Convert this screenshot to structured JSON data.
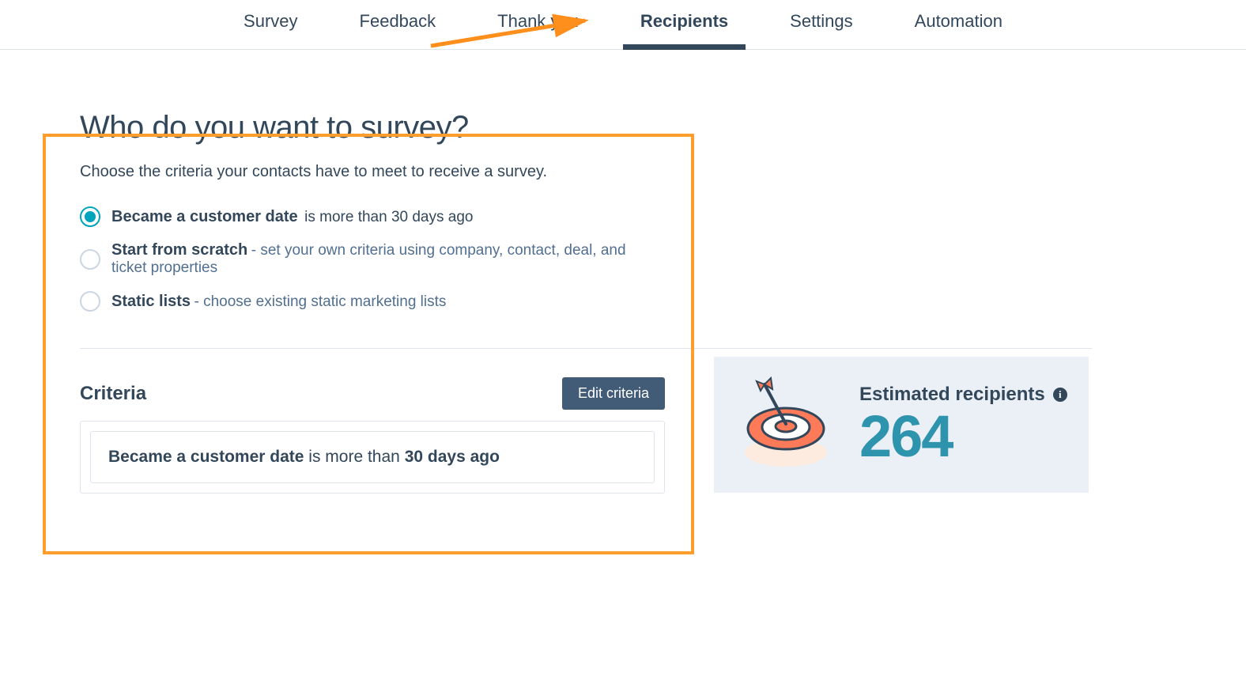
{
  "tabs": {
    "items": [
      {
        "label": "Survey",
        "active": false
      },
      {
        "label": "Feedback",
        "active": false
      },
      {
        "label": "Thank you",
        "active": false
      },
      {
        "label": "Recipients",
        "active": true
      },
      {
        "label": "Settings",
        "active": false
      },
      {
        "label": "Automation",
        "active": false
      }
    ]
  },
  "page": {
    "title": "Who do you want to survey?",
    "description": "Choose the criteria your contacts have to meet to receive a survey."
  },
  "options": [
    {
      "label": "Became a customer date",
      "suffix": "is more than 30 days ago",
      "selected": true
    },
    {
      "label": "Start from scratch",
      "description": "- set your own criteria using company, contact, deal, and ticket properties",
      "selected": false
    },
    {
      "label": "Static lists",
      "description": "- choose existing static marketing lists",
      "selected": false
    }
  ],
  "criteria": {
    "section_label": "Criteria",
    "edit_button": "Edit criteria",
    "rule": {
      "field": "Became a customer date",
      "operator_text": " is more than ",
      "value": "30 days ago"
    }
  },
  "estimate": {
    "label": "Estimated recipients",
    "count": "264"
  },
  "icons": {
    "info_glyph": "i"
  }
}
